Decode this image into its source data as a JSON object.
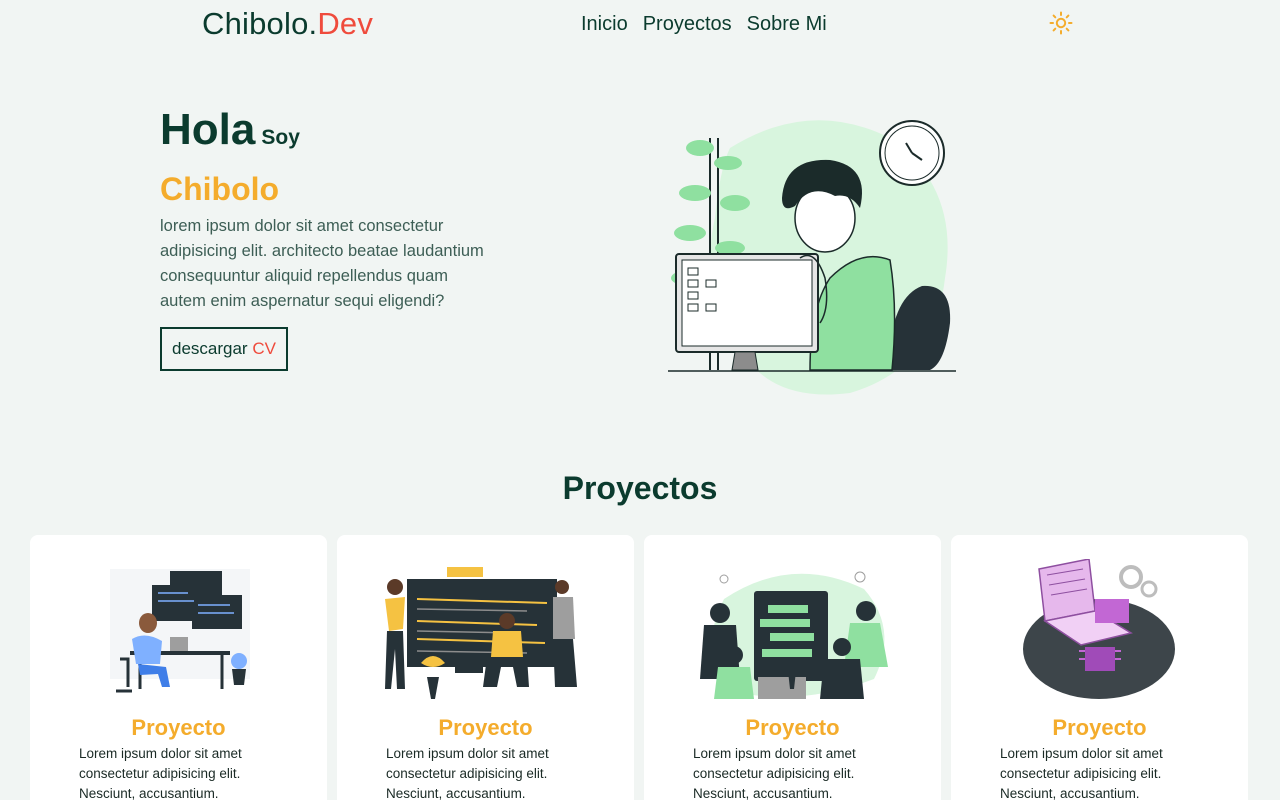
{
  "nav": {
    "logo_main": "Chibolo.",
    "logo_accent": "Dev",
    "links": [
      "Inicio",
      "Proyectos",
      "Sobre Mi"
    ],
    "theme_icon": "sun-icon"
  },
  "hero": {
    "greeting": "Hola",
    "greeting_small": "Soy",
    "name": "Chibolo",
    "description": "lorem ipsum dolor sit amet consectetur adipisicing elit. architecto beatae laudantium consequuntur aliquid repellendus quam autem enim aspernatur sequi eligendi?",
    "cv_label": "descargar",
    "cv_accent": "CV"
  },
  "projects": {
    "title": "Proyectos",
    "cards": [
      {
        "title": "Proyecto",
        "description": "Lorem ipsum dolor sit amet consectetur adipisicing elit. Nesciunt, accusantium."
      },
      {
        "title": "Proyecto",
        "description": "Lorem ipsum dolor sit amet consectetur adipisicing elit. Nesciunt, accusantium."
      },
      {
        "title": "Proyecto",
        "description": "Lorem ipsum dolor sit amet consectetur adipisicing elit. Nesciunt, accusantium."
      },
      {
        "title": "Proyecto",
        "description": "Lorem ipsum dolor sit amet consectetur adipisicing elit. Nesciunt, accusantium."
      }
    ]
  },
  "colors": {
    "background": "#f1f5f3",
    "primary": "#0b3b2e",
    "accent_red": "#ef4b3c",
    "accent_yellow": "#f4ac2c",
    "illustration_green": "#8fe0a0"
  }
}
